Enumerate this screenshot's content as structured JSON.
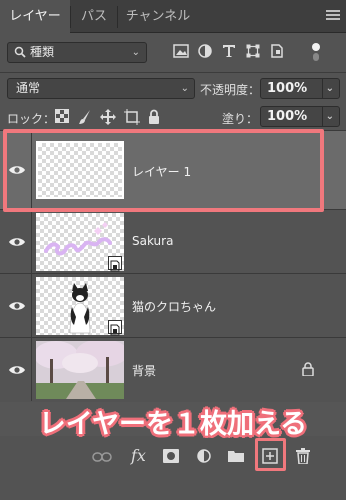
{
  "tabs": [
    {
      "label": "レイヤー"
    },
    {
      "label": "パス"
    },
    {
      "label": "チャンネル"
    }
  ],
  "filter": {
    "kind_label": "種類",
    "icons": [
      "pixel-filter-icon",
      "adjustment-filter-icon",
      "type-filter-icon",
      "shape-filter-icon",
      "smart-object-filter-icon",
      "filter-toggle-icon"
    ]
  },
  "blend": {
    "mode": "通常",
    "opacity_label": "不透明度：",
    "opacity_value": "100%"
  },
  "lock": {
    "label": "ロック：",
    "fill_label": "塗り：",
    "fill_value": "100%",
    "icons": [
      "lock-transparent-icon",
      "lock-image-icon",
      "lock-position-icon",
      "lock-artboard-icon",
      "lock-all-icon"
    ]
  },
  "layers": [
    {
      "name": "レイヤー 1",
      "selected": true,
      "type": "transparent"
    },
    {
      "name": "Sakura",
      "selected": false,
      "type": "smart-text"
    },
    {
      "name": "猫のクロちゃん",
      "selected": false,
      "type": "smart-cat"
    },
    {
      "name": "背景",
      "selected": false,
      "type": "background",
      "locked": true
    }
  ],
  "banner": {
    "text": "レイヤーを１枚加える",
    "color": "#ef6f7a"
  },
  "bottom_bar": {
    "icons": [
      "link-layers-icon",
      "fx-icon",
      "add-mask-icon",
      "adjustment-layer-icon",
      "new-group-icon",
      "new-layer-icon",
      "delete-icon"
    ],
    "fx_label": "fx"
  }
}
